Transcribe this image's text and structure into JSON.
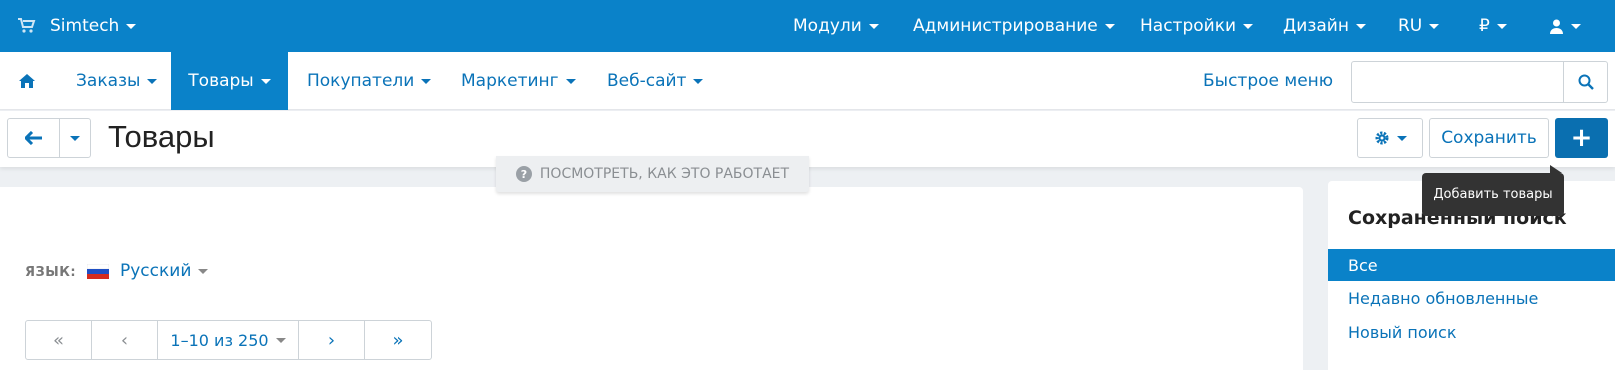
{
  "topbar": {
    "brand": "Simtech",
    "menus": [
      {
        "label": "Модули"
      },
      {
        "label": "Администрирование"
      },
      {
        "label": "Настройки"
      },
      {
        "label": "Дизайн"
      },
      {
        "label": "RU"
      },
      {
        "label": "₽"
      }
    ],
    "icons": {
      "cart": "cart-icon",
      "user": "user-icon"
    }
  },
  "subnav": {
    "items": [
      {
        "label": "Заказы"
      },
      {
        "label": "Товары",
        "active": true
      },
      {
        "label": "Покупатели"
      },
      {
        "label": "Маркетинг"
      },
      {
        "label": "Веб-сайт"
      }
    ],
    "quick_menu": "Быстрое меню",
    "search_placeholder": ""
  },
  "toolbar": {
    "title": "Товары",
    "save_label": "Сохранить",
    "add_label": "+"
  },
  "howto": {
    "label": "ПОСМОТРЕТЬ, КАК ЭТО РАБОТАЕТ"
  },
  "tooltip": {
    "text": "Добавить товары"
  },
  "main": {
    "lang_label": "ЯЗЫК:",
    "lang_value": "Русский",
    "pager": {
      "first": "«",
      "prev": "‹",
      "range": "1–10 из 250",
      "next": "›",
      "last": "»"
    }
  },
  "sidebar": {
    "title": "Сохраненный поиск",
    "items": [
      {
        "label": "Все",
        "active": true
      },
      {
        "label": "Недавно обновленные"
      },
      {
        "label": "Новый поиск"
      }
    ]
  },
  "colors": {
    "accent": "#0a82c9",
    "link": "#0a73b8",
    "primary_btn": "#0a6fb0"
  }
}
